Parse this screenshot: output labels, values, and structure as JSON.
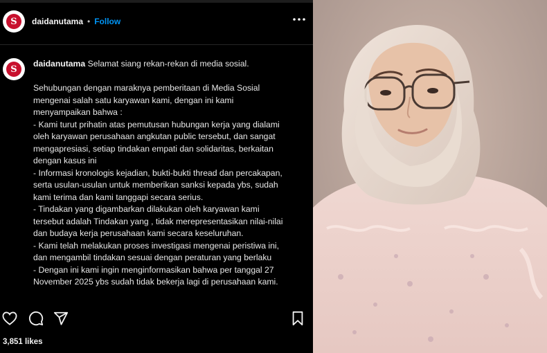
{
  "post": {
    "username": "daidanutama",
    "separator": "•",
    "follow_label": "Follow",
    "avatar_letter": "S",
    "caption_greeting": "Selamat siang rekan-rekan di media sosial.",
    "caption_lines": [
      "Sehubungan dengan maraknya pemberitaan di Media Sosial",
      "mengenai salah satu karyawan kami, dengan ini kami",
      "menyampaikan bahwa :",
      "- Kami turut prihatin atas pemutusan hubungan kerja yang dialami",
      "oleh karyawan perusahaan angkutan public tersebut, dan sangat",
      "mengapresiasi, setiap tindakan empati dan solidaritas, berkaitan",
      "dengan kasus ini",
      "- Informasi kronologis kejadian, bukti-bukti thread dan percakapan,",
      "serta usulan-usulan untuk memberikan sanksi kepada ybs, sudah",
      "kami terima dan kami tanggapi secara serius.",
      "- Tindakan yang digambarkan dilakukan oleh karyawan kami",
      "tersebut adalah Tindakan yang , tidak merepresentasikan nilai-nilai",
      "dan budaya kerja perusahaan kami secara keseluruhan.",
      "- Kami telah melakukan proses investigasi mengenai peristiwa ini,",
      "dan mengambil tindakan sesuai dengan peraturan yang berlaku",
      "- Dengan ini kami ingin menginformasikan bahwa per tanggal 27",
      "November 2025 ybs sudah tidak bekerja lagi di perusahaan kami."
    ],
    "likes": "3,851 likes",
    "icons": {
      "more": "more-options-icon",
      "like": "heart-icon",
      "comment": "comment-icon",
      "share": "share-icon",
      "save": "bookmark-icon"
    }
  },
  "colors": {
    "background": "#000000",
    "text": "#f2f2f2",
    "follow": "#0095f6",
    "avatar_red": "#c8102e"
  }
}
